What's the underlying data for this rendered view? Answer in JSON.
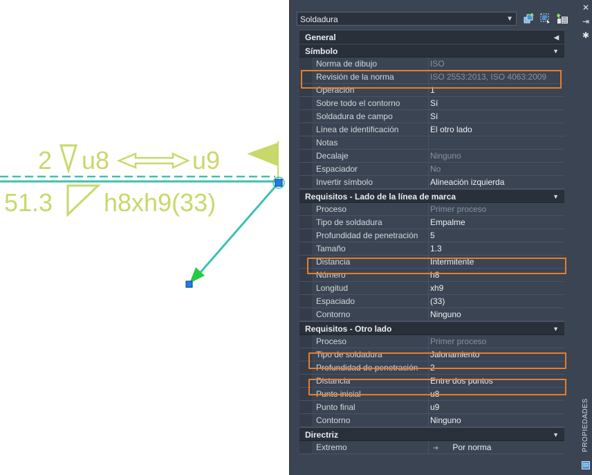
{
  "panel": {
    "object_type": "Soldadura",
    "side_label": "PROPIEDADES",
    "sections": [
      {
        "title": "General",
        "collapsed": true,
        "rows": []
      },
      {
        "title": "Símbolo",
        "collapsed": false,
        "rows": [
          {
            "label": "Norma de dibujo",
            "value": "ISO",
            "dim": true
          },
          {
            "label": "Revisión de la norma",
            "value": "ISO 2553:2013, ISO 4063:2009",
            "dim": true
          },
          {
            "label": "Operación",
            "value": "1",
            "dim": false
          },
          {
            "label": "Sobre todo el contorno",
            "value": "Sí",
            "dim": false
          },
          {
            "label": "Soldadura de campo",
            "value": "Sí",
            "dim": false
          },
          {
            "label": "Línea de identificación",
            "value": "El otro lado",
            "dim": false
          },
          {
            "label": "Notas",
            "value": "",
            "dim": false
          },
          {
            "label": "Decalaje",
            "value": "Ninguno",
            "dim": true
          },
          {
            "label": "Espaciador",
            "value": "No",
            "dim": true
          },
          {
            "label": "Invertir símbolo",
            "value": "Alineación izquierda",
            "dim": false
          }
        ]
      },
      {
        "title": "Requisitos - Lado de la línea de marca",
        "collapsed": false,
        "rows": [
          {
            "label": "Proceso",
            "value": "Primer proceso",
            "dim": true
          },
          {
            "label": "Tipo de soldadura",
            "value": "Empalme",
            "dim": false
          },
          {
            "label": "Profundidad de penetración",
            "value": "5",
            "dim": false
          },
          {
            "label": "Tamaño",
            "value": "1.3",
            "dim": false
          },
          {
            "label": "Distancia",
            "value": "Intermitente",
            "dim": false
          },
          {
            "label": "Número",
            "value": "h8",
            "dim": false
          },
          {
            "label": "Longitud",
            "value": "xh9",
            "dim": false
          },
          {
            "label": "Espaciado",
            "value": "(33)",
            "dim": false
          },
          {
            "label": "Contorno",
            "value": "Ninguno",
            "dim": false
          }
        ]
      },
      {
        "title": "Requisitos - Otro lado",
        "collapsed": false,
        "rows": [
          {
            "label": "Proceso",
            "value": "Primer proceso",
            "dim": true
          },
          {
            "label": "Tipo de soldadura",
            "value": "Jalonamiento",
            "dim": false
          },
          {
            "label": "Profundidad de penetración",
            "value": "2",
            "dim": false
          },
          {
            "label": "Distancia",
            "value": "Entre dos puntos",
            "dim": false
          },
          {
            "label": "Punto inicial",
            "value": "u8",
            "dim": false
          },
          {
            "label": "Punto final",
            "value": "u9",
            "dim": false
          },
          {
            "label": "Contorno",
            "value": "Ninguno",
            "dim": false
          }
        ]
      },
      {
        "title": "Directriz",
        "collapsed": false,
        "rows": [
          {
            "label": "Extremo",
            "value": "Por norma",
            "dim": false
          }
        ]
      }
    ]
  },
  "drawing": {
    "top_count": "2",
    "top_start": "u8",
    "top_end": "u9",
    "bottom_size": "51.3",
    "bottom_dims": "h8xh9(33)"
  },
  "colors": {
    "annotation": "#c8d86a",
    "leader": "#3cc0b0",
    "highlight": "#e87e2c",
    "grip": "#1e7ee8"
  }
}
